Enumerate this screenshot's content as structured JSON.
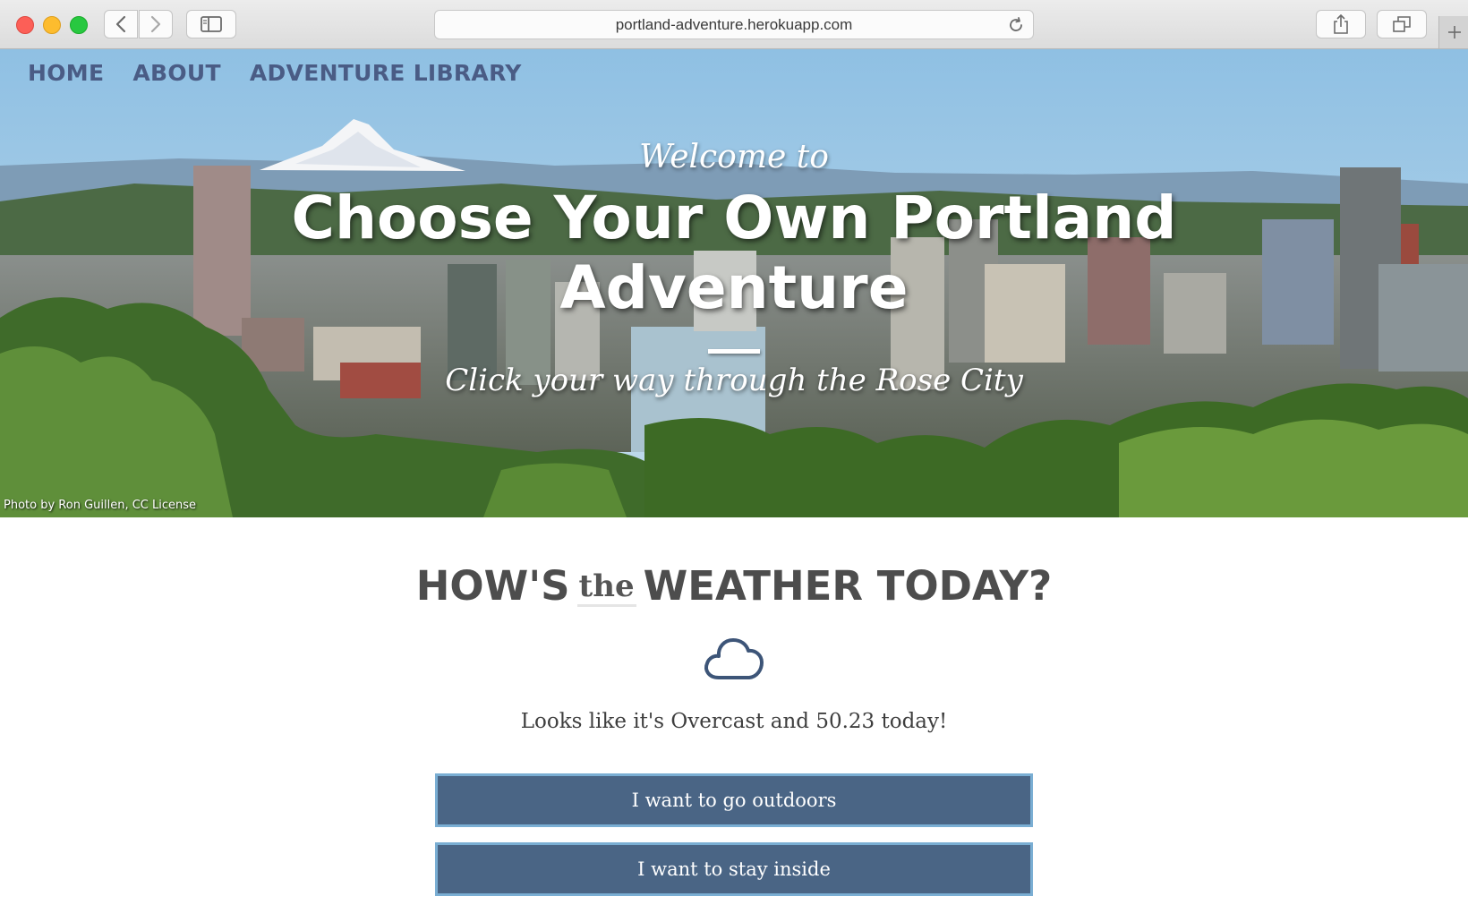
{
  "browser": {
    "url": "portland-adventure.herokuapp.com",
    "icons": [
      "back-icon",
      "forward-icon",
      "sidebar-icon",
      "reload-icon",
      "share-icon",
      "tabs-icon",
      "plus-icon"
    ]
  },
  "nav": {
    "items": [
      {
        "label": "HOME"
      },
      {
        "label": "ABOUT"
      },
      {
        "label": "ADVENTURE LIBRARY"
      }
    ]
  },
  "hero": {
    "welcome": "Welcome to",
    "title": "Choose Your Own Portland Adventure",
    "tagline": "Click your way through the Rose City",
    "photo_credit": "Photo by Ron Guillen, CC License"
  },
  "weather": {
    "heading_before": "HOW'S",
    "heading_the": "the",
    "heading_after": "WEATHER TODAY?",
    "icon": "cloud-icon",
    "message": "Looks like it's Overcast and 50.23 today!",
    "buttons": [
      {
        "label": "I want to go outdoors"
      },
      {
        "label": "I want to stay inside"
      }
    ]
  },
  "colors": {
    "nav_text": "#4a5c85",
    "button_bg": "#4a6585",
    "button_border": "#7aaed3",
    "heading_text": "#4d4d4d"
  }
}
